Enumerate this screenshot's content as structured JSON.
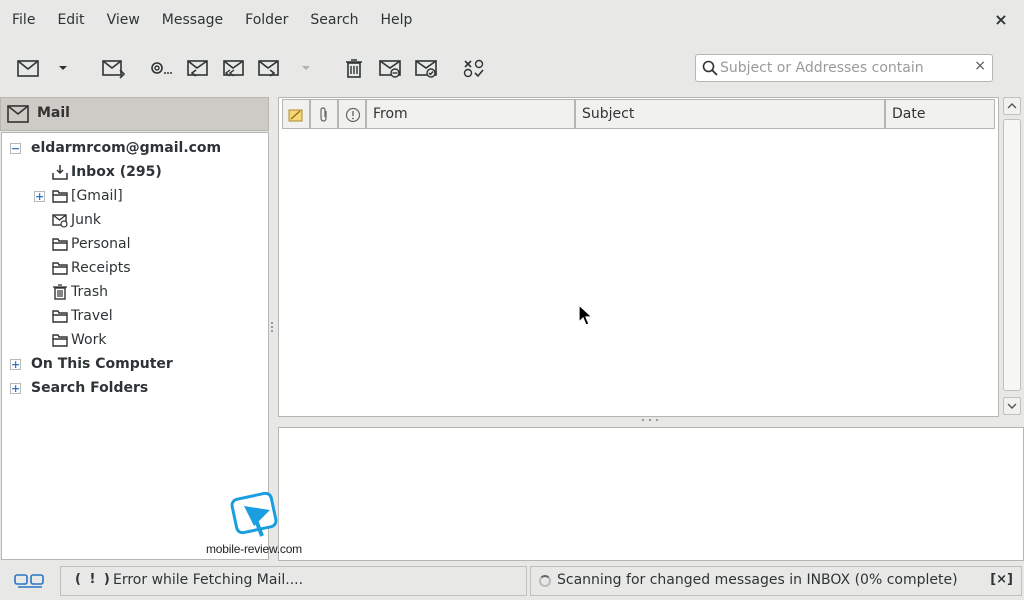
{
  "menubar": {
    "items": [
      "File",
      "Edit",
      "View",
      "Message",
      "Folder",
      "Search",
      "Help"
    ],
    "close_label": "×"
  },
  "toolbar": {
    "buttons": [
      {
        "name": "new-message-icon"
      },
      {
        "name": "dropdown-arrow-icon"
      },
      {
        "name": "send-receive-icon"
      },
      {
        "name": "address-book-icon"
      },
      {
        "name": "reply-icon"
      },
      {
        "name": "reply-all-icon"
      },
      {
        "name": "forward-icon"
      },
      {
        "name": "forward-dropdown-icon"
      },
      {
        "name": "delete-icon"
      },
      {
        "name": "junk-icon"
      },
      {
        "name": "not-junk-icon"
      },
      {
        "name": "cancel-icon"
      }
    ]
  },
  "search": {
    "placeholder": "Subject or Addresses contain",
    "clear_label": "×"
  },
  "sidebar": {
    "title": "Mail",
    "account": "eldarmrcom@gmail.com",
    "folders": [
      {
        "label": "Inbox (295)",
        "icon": "inbox-icon",
        "bold": true
      },
      {
        "label": "[Gmail]",
        "icon": "folder-icon",
        "expandable": true
      },
      {
        "label": "Junk",
        "icon": "junk-folder-icon"
      },
      {
        "label": "Personal",
        "icon": "folder-icon"
      },
      {
        "label": "Receipts",
        "icon": "folder-icon"
      },
      {
        "label": "Trash",
        "icon": "trash-icon"
      },
      {
        "label": "Travel",
        "icon": "folder-icon"
      },
      {
        "label": "Work",
        "icon": "folder-icon"
      }
    ],
    "groups": [
      "On This Computer",
      "Search Folders"
    ]
  },
  "message_list": {
    "columns": [
      "From",
      "Subject",
      "Date"
    ]
  },
  "watermark": {
    "text": "mobile-review.com"
  },
  "status": {
    "error_mark": "( ! )",
    "error_text": "Error while Fetching Mail....",
    "progress_text": "Scanning for changed messages in INBOX (0% complete)",
    "cancel_label": "[×]"
  },
  "colors": {
    "accent": "#2a76c6",
    "background": "#e8e8e7",
    "header": "#cdcbc5"
  }
}
